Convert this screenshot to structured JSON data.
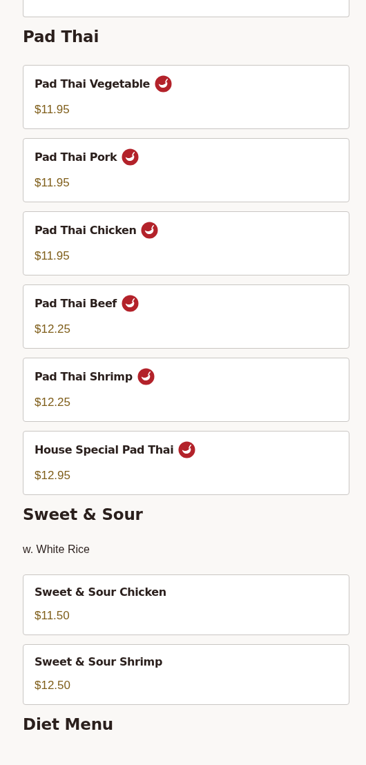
{
  "sections": [
    {
      "title": "Pad Thai",
      "items": [
        {
          "name": "Pad Thai Vegetable",
          "price": "$11.95",
          "spicy": true
        },
        {
          "name": "Pad Thai Pork",
          "price": "$11.95",
          "spicy": true
        },
        {
          "name": "Pad Thai Chicken",
          "price": "$11.95",
          "spicy": true
        },
        {
          "name": "Pad Thai Beef",
          "price": "$12.25",
          "spicy": true
        },
        {
          "name": "Pad Thai Shrimp",
          "price": "$12.25",
          "spicy": true
        },
        {
          "name": "House Special Pad Thai",
          "price": "$12.95",
          "spicy": true
        }
      ]
    },
    {
      "title": "Sweet & Sour",
      "note": "w. White Rice",
      "items": [
        {
          "name": "Sweet & Sour Chicken",
          "price": "$11.50",
          "spicy": false
        },
        {
          "name": "Sweet & Sour Shrimp",
          "price": "$12.50",
          "spicy": false
        }
      ]
    },
    {
      "title": "Diet Menu"
    }
  ]
}
